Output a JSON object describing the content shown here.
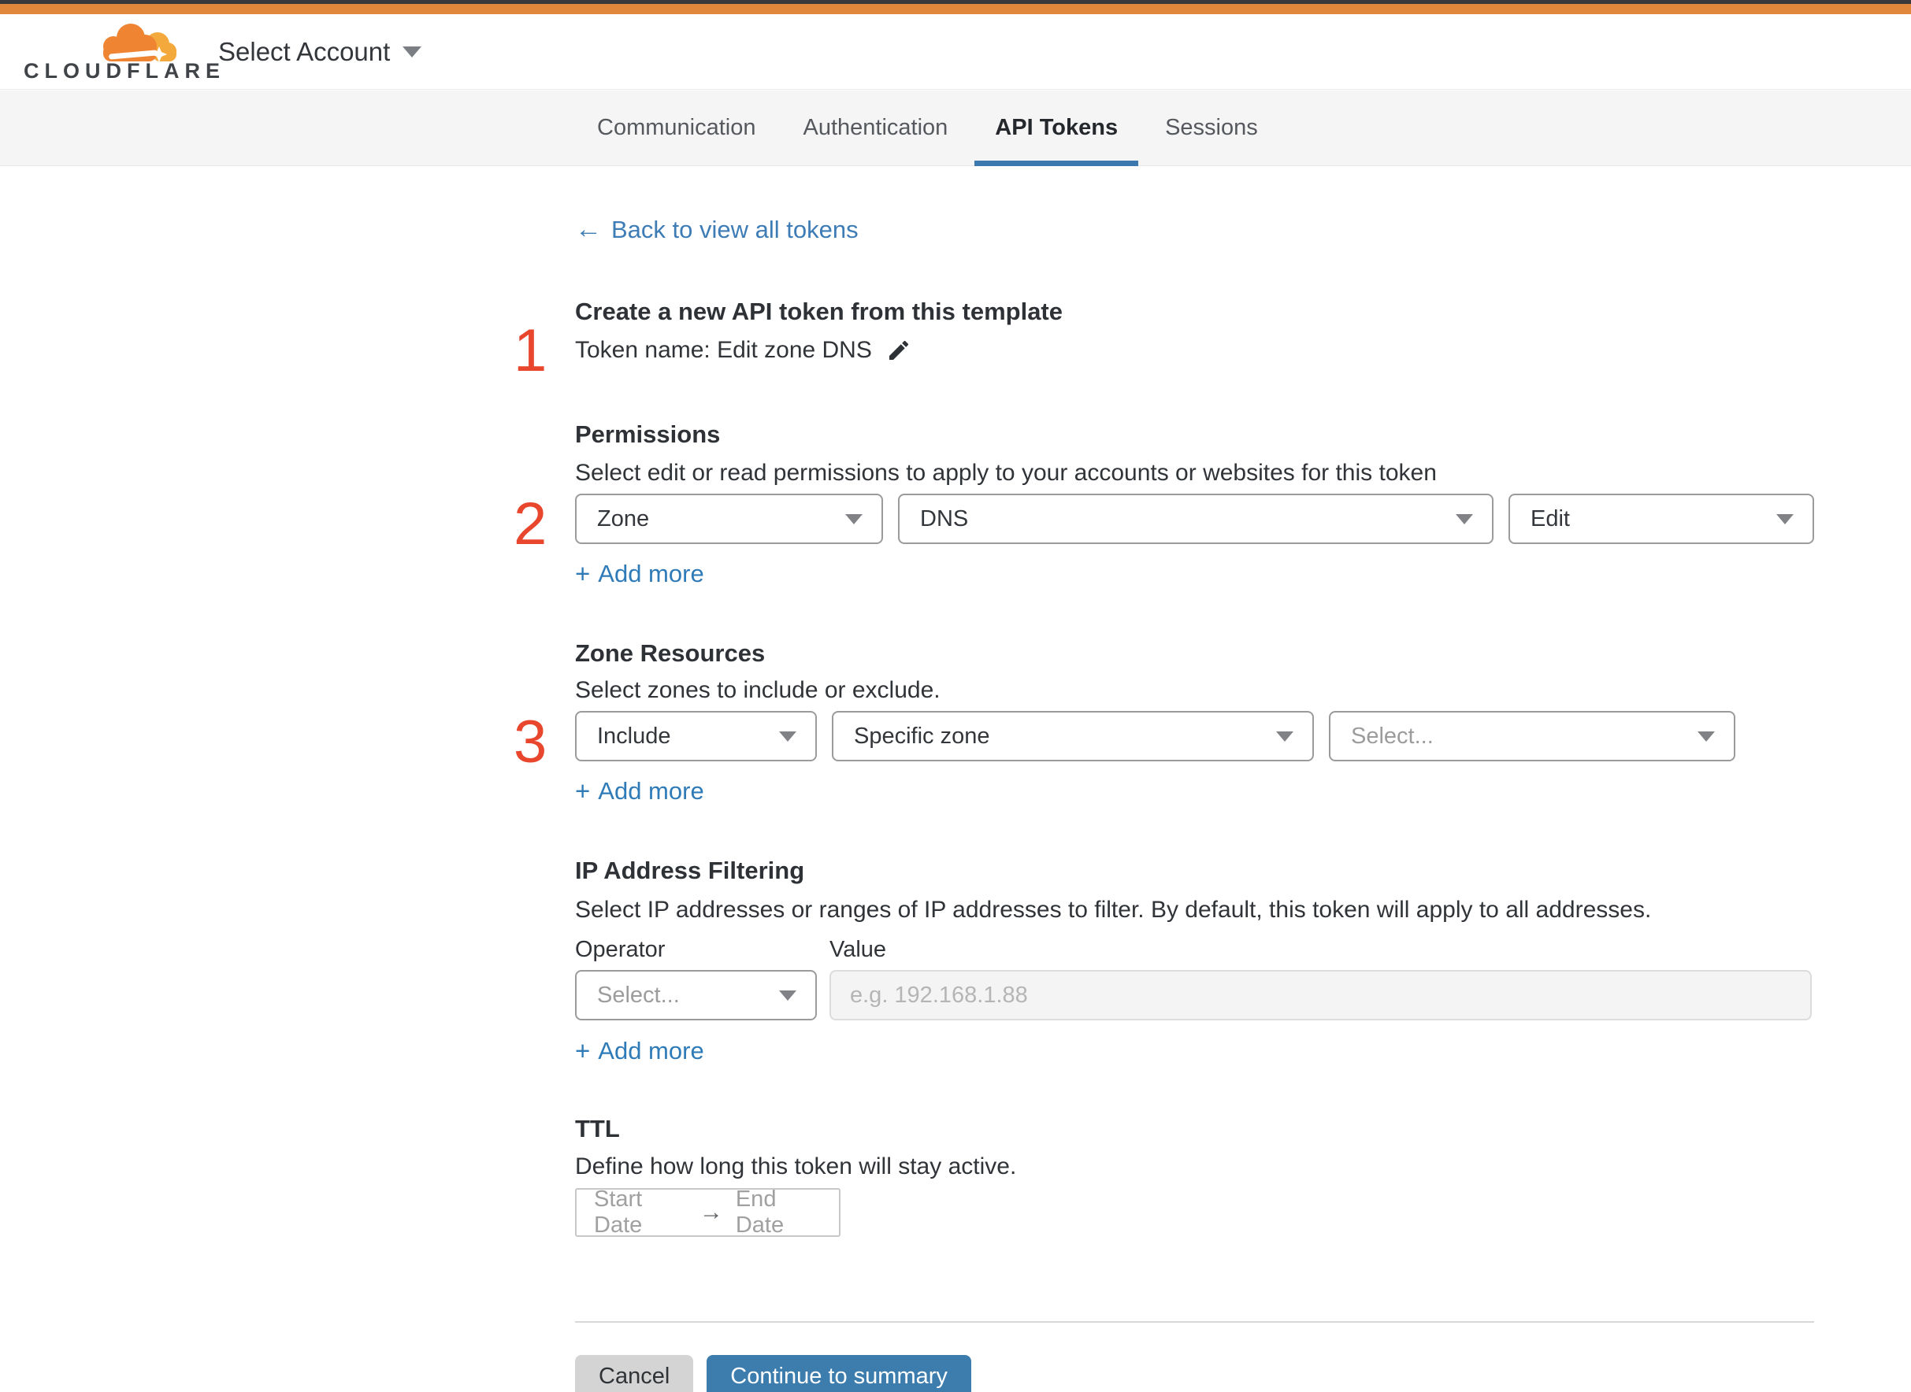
{
  "topbar": {
    "select_account_label": "Select Account"
  },
  "brand": {
    "name": "CLOUDFLARE"
  },
  "tabs": [
    {
      "label": "Communication",
      "active": false
    },
    {
      "label": "Authentication",
      "active": false
    },
    {
      "label": "API Tokens",
      "active": true
    },
    {
      "label": "Sessions",
      "active": false
    }
  ],
  "back_link": {
    "arrow": "←",
    "label": "Back to view all tokens"
  },
  "steps": {
    "one": "1",
    "two": "2",
    "three": "3"
  },
  "token_section": {
    "title": "Create a new API token from this template",
    "token_name_label": "Token name: Edit zone DNS"
  },
  "permissions": {
    "title": "Permissions",
    "description": "Select edit or read permissions to apply to your accounts or websites for this token",
    "selects": [
      {
        "value": "Zone"
      },
      {
        "value": "DNS"
      },
      {
        "value": "Edit"
      }
    ],
    "add_more_label": "Add more"
  },
  "zone_resources": {
    "title": "Zone Resources",
    "description": "Select zones to include or exclude.",
    "selects": [
      {
        "value": "Include"
      },
      {
        "value": "Specific zone"
      },
      {
        "placeholder": "Select..."
      }
    ],
    "add_more_label": "Add more"
  },
  "ip_filtering": {
    "title": "IP Address Filtering",
    "description": "Select IP addresses or ranges of IP addresses to filter. By default, this token will apply to all addresses.",
    "operator_label": "Operator",
    "value_label": "Value",
    "operator_placeholder": "Select...",
    "value_placeholder": "e.g. 192.168.1.88",
    "add_more_label": "Add more"
  },
  "ttl": {
    "title": "TTL",
    "description": "Define how long this token will stay active.",
    "start_label": "Start Date",
    "arrow": "→",
    "end_label": "End Date"
  },
  "footer": {
    "cancel_label": "Cancel",
    "continue_label": "Continue to summary"
  },
  "misc": {
    "plus": "+"
  },
  "colors": {
    "brand_orange": "#e0873c",
    "logo_orange": "#ef8432",
    "logo_light_orange": "#f4a93d",
    "accent_blue": "#3c7dae",
    "tab_underline_blue": "#3b79ae",
    "link_blue": "#3d7cb5",
    "step_red": "#e8462d"
  }
}
